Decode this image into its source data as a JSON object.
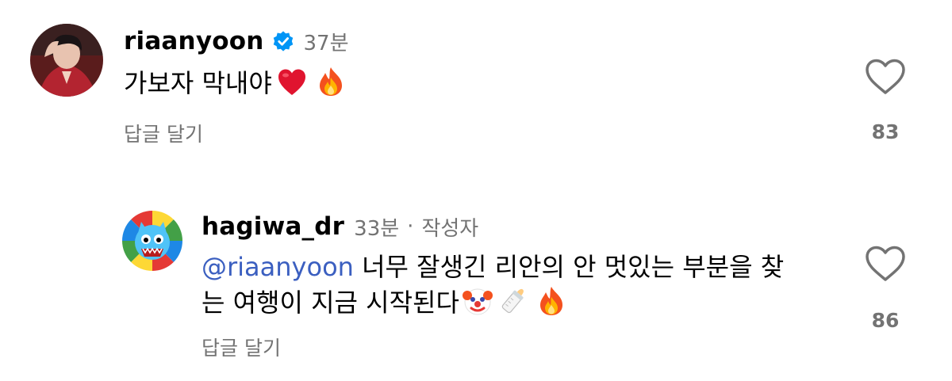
{
  "comments": [
    {
      "username": "riaanyoon",
      "verified": true,
      "time": "37분",
      "text": "가보자 막내야",
      "emoji": [
        "red-heart",
        "fire"
      ],
      "reply_label": "답글 달기",
      "like_count": "83"
    },
    {
      "username": "hagiwa_dr",
      "time": "33분",
      "separator": "·",
      "author_tag": "작성자",
      "mention": "@riaanyoon",
      "text_line1": "너무 잘생긴 리안의 안 멋있는 부분을 찾",
      "text_line2": "는 여행이 지금 시작된다",
      "emoji": [
        "clown-face",
        "baby-bottle",
        "fire"
      ],
      "reply_label": "답글 달기",
      "like_count": "86"
    }
  ],
  "colors": {
    "text": "#000000",
    "secondary": "#737373",
    "mention": "#3b5fc0",
    "verified_badge": "#0095f6",
    "heart": "#e0142f"
  }
}
